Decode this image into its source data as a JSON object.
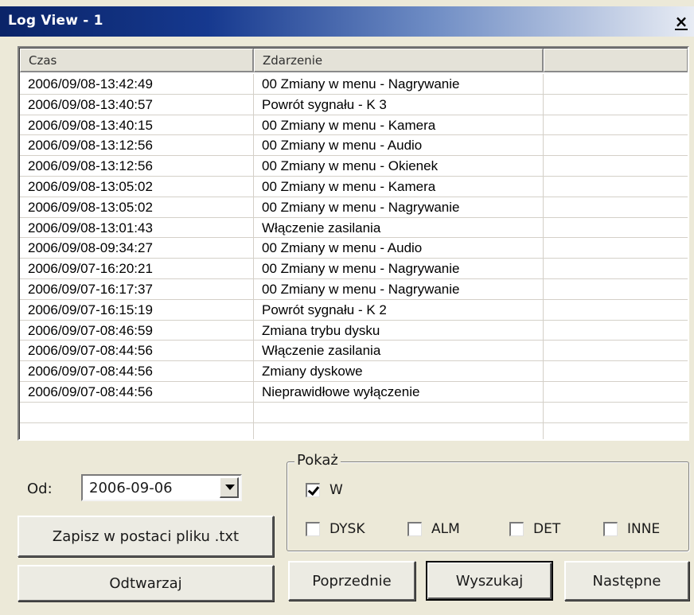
{
  "window": {
    "title": "Log View - 1",
    "close_glyph": "×"
  },
  "log": {
    "columns": [
      "Czas",
      "Zdarzenie",
      ""
    ],
    "rows": [
      [
        "2006/09/08-13:42:49",
        "00 Zmiany w menu - Nagrywanie"
      ],
      [
        "2006/09/08-13:40:57",
        "Powrót sygnału - K 3"
      ],
      [
        "2006/09/08-13:40:15",
        "00 Zmiany w menu - Kamera"
      ],
      [
        "2006/09/08-13:12:56",
        "00 Zmiany w menu - Audio"
      ],
      [
        "2006/09/08-13:12:56",
        "00 Zmiany w menu - Okienek"
      ],
      [
        "2006/09/08-13:05:02",
        "00 Zmiany w menu - Kamera"
      ],
      [
        "2006/09/08-13:05:02",
        "00 Zmiany w menu - Nagrywanie"
      ],
      [
        "2006/09/08-13:01:43",
        "Włączenie zasilania"
      ],
      [
        "2006/09/08-09:34:27",
        "00 Zmiany w menu - Audio"
      ],
      [
        "2006/09/07-16:20:21",
        "00 Zmiany w menu - Nagrywanie"
      ],
      [
        "2006/09/07-16:17:37",
        "00 Zmiany w menu - Nagrywanie"
      ],
      [
        "2006/09/07-16:15:19",
        "Powrót sygnału - K 2"
      ],
      [
        "2006/09/07-08:46:59",
        "Zmiana trybu dysku"
      ],
      [
        "2006/09/07-08:44:56",
        "Włączenie zasilania"
      ],
      [
        "2006/09/07-08:44:56",
        "Zmiany dyskowe"
      ],
      [
        "2006/09/07-08:44:56",
        "Nieprawidłowe wyłączenie"
      ],
      [
        "",
        ""
      ],
      [
        "",
        ""
      ]
    ]
  },
  "filters": {
    "from_label": "Od:",
    "from_value": "2006-09-06",
    "show_group_title": "Pokaż",
    "checkboxes": [
      {
        "label": "W",
        "checked": true
      },
      {
        "label": "DYSK",
        "checked": false
      },
      {
        "label": "ALM",
        "checked": false
      },
      {
        "label": "DET",
        "checked": false
      },
      {
        "label": "INNE",
        "checked": false
      }
    ]
  },
  "buttons": {
    "save_txt": "Zapisz w postaci pliku .txt",
    "play": "Odtwarzaj",
    "previous": "Poprzednie",
    "search": "Wyszukaj",
    "next": "Następne"
  }
}
